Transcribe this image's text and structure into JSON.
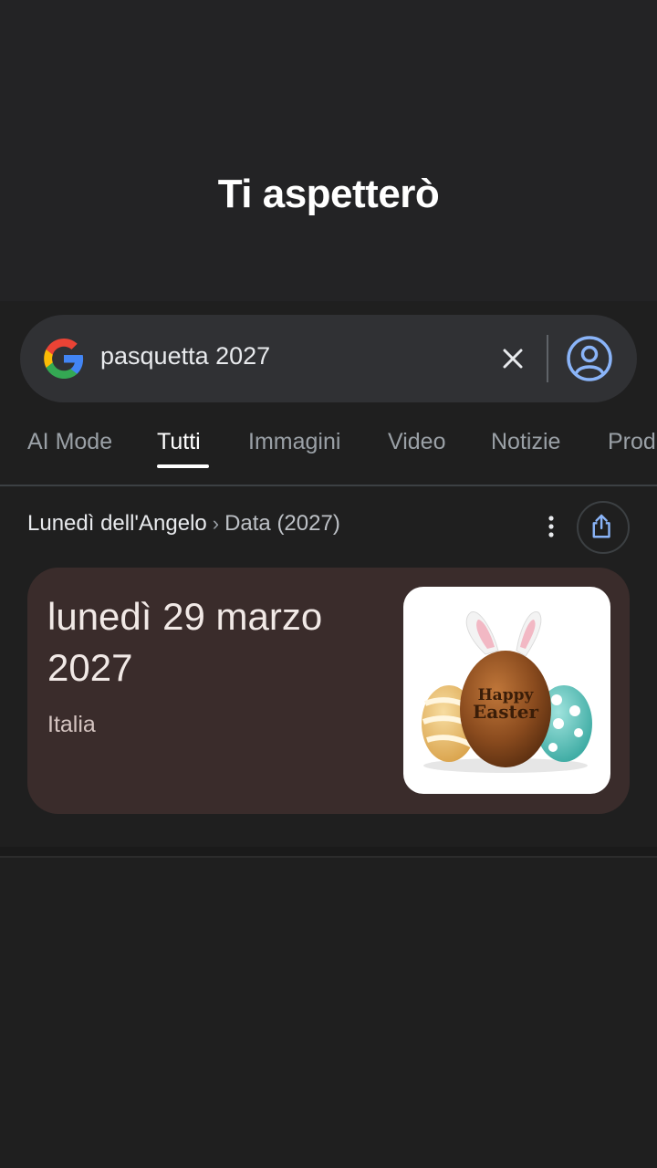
{
  "overlay": {
    "caption": "Ti aspetterò"
  },
  "search": {
    "query": "pasquetta 2027"
  },
  "tabs": [
    {
      "label": "AI Mode"
    },
    {
      "label": "Tutti"
    },
    {
      "label": "Immagini"
    },
    {
      "label": "Video"
    },
    {
      "label": "Notizie"
    },
    {
      "label": "Prod"
    }
  ],
  "result": {
    "breadcrumb_entity": "Lunedì dell'Angelo",
    "breadcrumb_separator": "›",
    "breadcrumb_attribute": "Data (2027)",
    "date_line1": "lunedì 29 marzo",
    "date_line2": "2027",
    "country": "Italia",
    "image_text_line1": "Happy",
    "image_text_line2": "Easter"
  },
  "colors": {
    "background": "#1f1f1f",
    "search_bar": "#303134",
    "card": "#3a2c2b",
    "account_icon": "#8ab4f8"
  },
  "icons": [
    "google-g-icon",
    "close-icon",
    "account-circle-icon",
    "more-vert-icon",
    "share-icon"
  ]
}
